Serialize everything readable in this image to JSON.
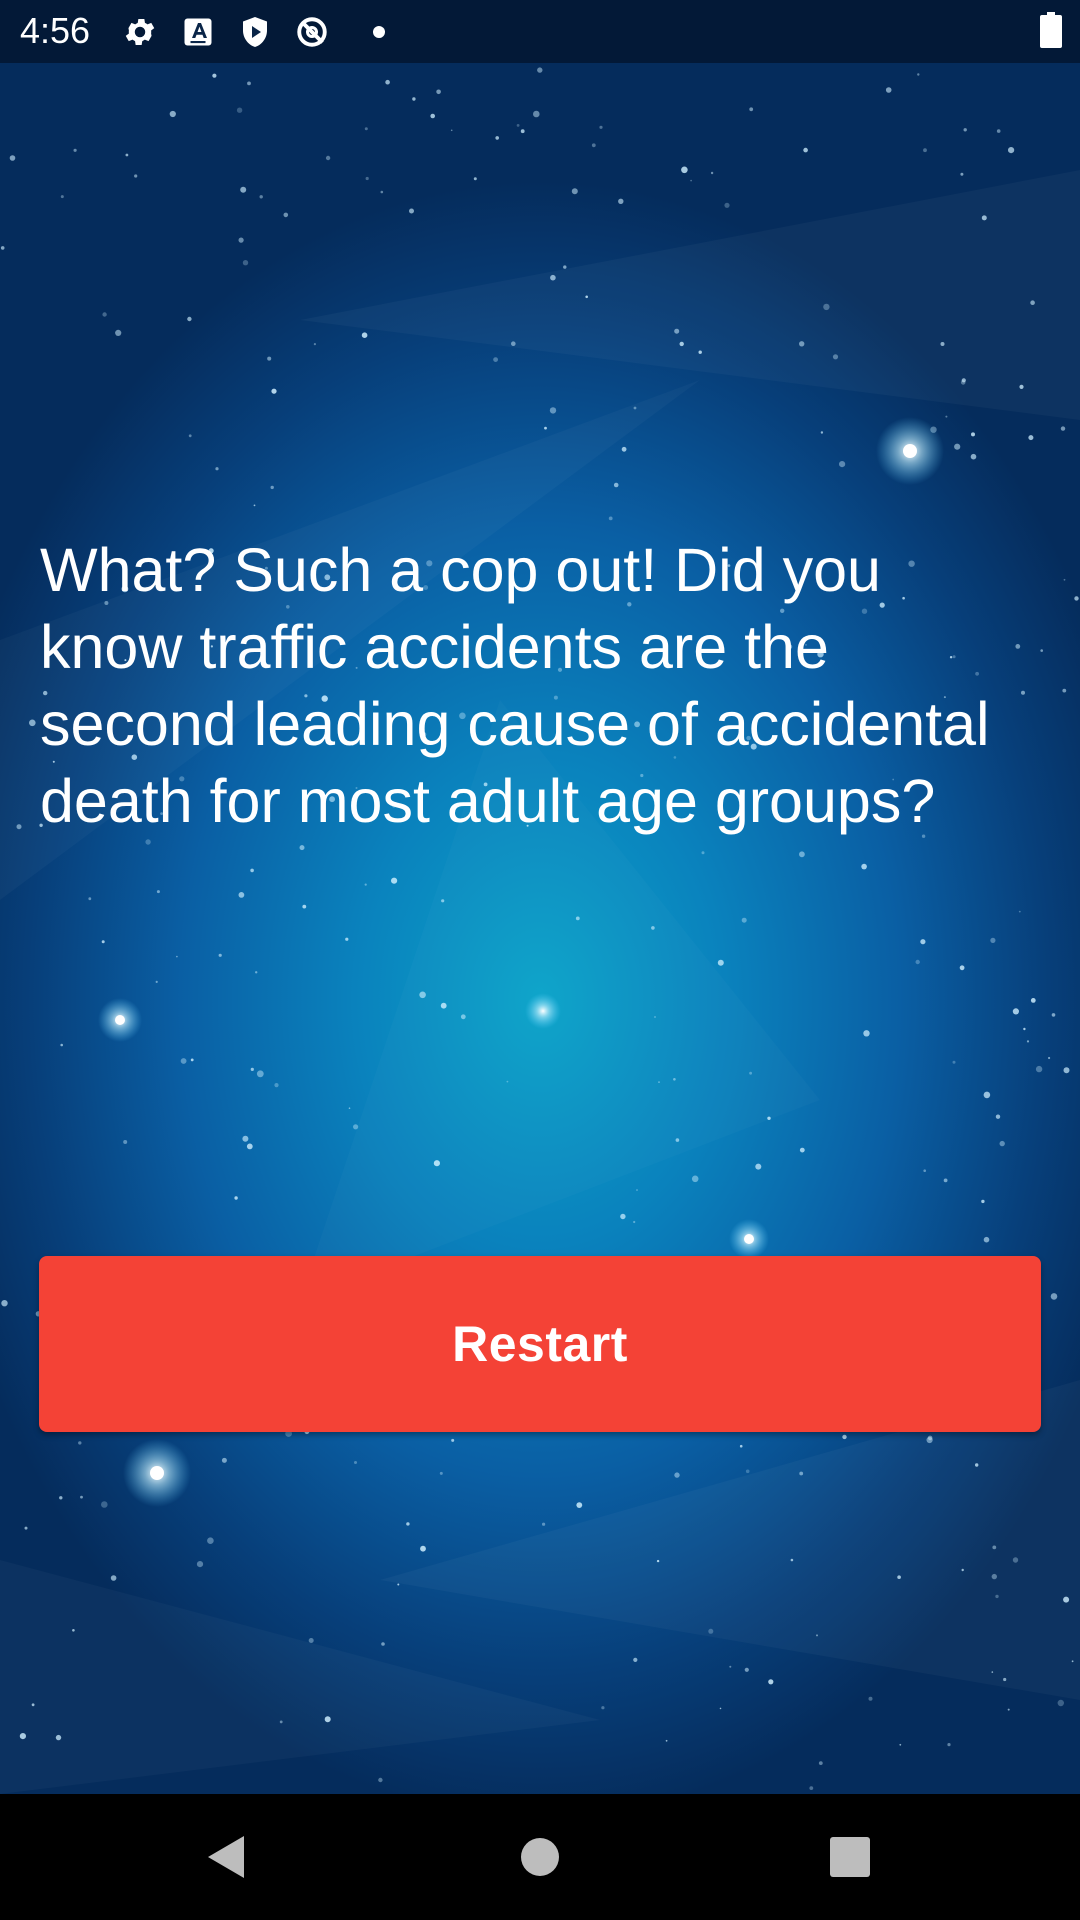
{
  "status_bar": {
    "time": "4:56",
    "icons": [
      "settings-icon",
      "text-a-icon",
      "play-shield-icon",
      "no-sign-icon",
      "dot-icon",
      "battery-icon"
    ]
  },
  "main": {
    "message": "What? Such a cop out! Did you know traffic accidents are the second leading cause of accidental death for most adult age groups?",
    "restart_label": "Restart"
  },
  "colors": {
    "button": "#f44236",
    "background_center": "#0aa3c9",
    "background_edge": "#052c5c"
  },
  "nav_bar": {
    "icons": [
      "back-icon",
      "home-icon",
      "recents-icon"
    ]
  }
}
